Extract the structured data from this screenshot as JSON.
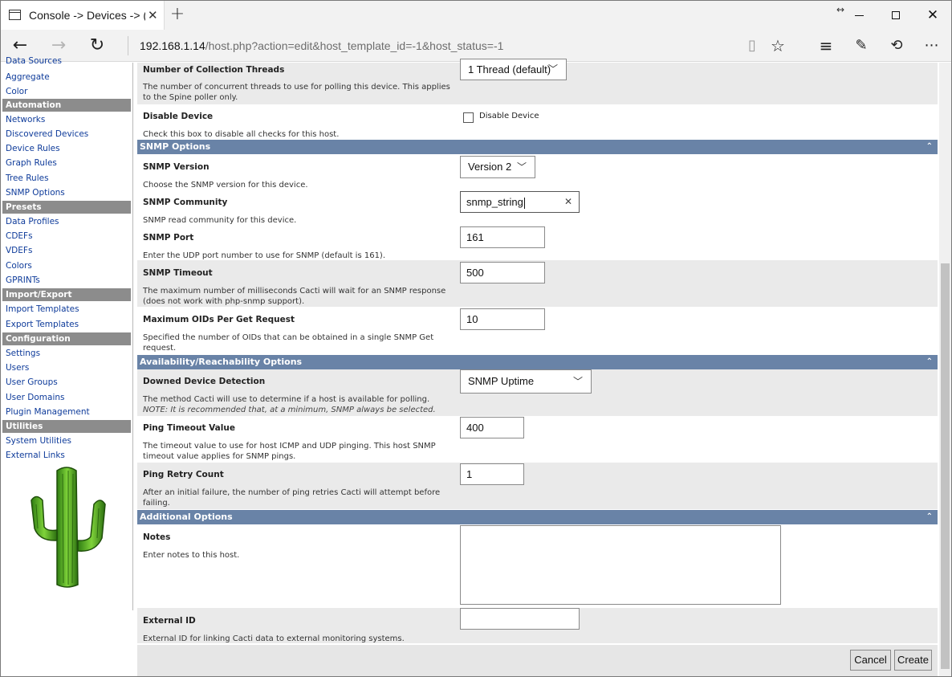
{
  "browser": {
    "tab_title": "Console -> Devices -> (",
    "tab_close": "✕",
    "new_tab": "+",
    "address_host": "192.168.1.14",
    "address_path": "/host.php?action=edit&host_template_id=-1&host_status=-1"
  },
  "sidebar": {
    "partial_item": "Data Sources",
    "groups": [
      {
        "type": "item",
        "label": "Aggregate"
      },
      {
        "type": "item",
        "label": "Color"
      },
      {
        "type": "header",
        "label": "Automation"
      },
      {
        "type": "item",
        "label": "Networks"
      },
      {
        "type": "item",
        "label": "Discovered Devices"
      },
      {
        "type": "item",
        "label": "Device Rules"
      },
      {
        "type": "item",
        "label": "Graph Rules"
      },
      {
        "type": "item",
        "label": "Tree Rules"
      },
      {
        "type": "item",
        "label": "SNMP Options"
      },
      {
        "type": "header",
        "label": "Presets"
      },
      {
        "type": "item",
        "label": "Data Profiles"
      },
      {
        "type": "item",
        "label": "CDEFs"
      },
      {
        "type": "item",
        "label": "VDEFs"
      },
      {
        "type": "item",
        "label": "Colors"
      },
      {
        "type": "item",
        "label": "GPRINTs"
      },
      {
        "type": "header",
        "label": "Import/Export"
      },
      {
        "type": "item",
        "label": "Import Templates"
      },
      {
        "type": "item",
        "label": "Export Templates"
      },
      {
        "type": "header",
        "label": "Configuration"
      },
      {
        "type": "item",
        "label": "Settings"
      },
      {
        "type": "item",
        "label": "Users"
      },
      {
        "type": "item",
        "label": "User Groups"
      },
      {
        "type": "item",
        "label": "User Domains"
      },
      {
        "type": "item",
        "label": "Plugin Management"
      },
      {
        "type": "header",
        "label": "Utilities"
      },
      {
        "type": "item",
        "label": "System Utilities"
      },
      {
        "type": "item",
        "label": "External Links"
      }
    ]
  },
  "form": {
    "threads": {
      "label": "Number of Collection Threads",
      "description": "The number of concurrent threads to use for polling this device. This applies to the Spine poller only.",
      "value": "1 Thread (default)"
    },
    "disable": {
      "label": "Disable Device",
      "description": "Check this box to disable all checks for this host.",
      "checkbox_label": "Disable Device",
      "checked": false
    },
    "snmp_section": "SNMP Options",
    "snmp_version": {
      "label": "SNMP Version",
      "description": "Choose the SNMP version for this device.",
      "value": "Version 2"
    },
    "snmp_community": {
      "label": "SNMP Community",
      "description": "SNMP read community for this device.",
      "value": "snmp_string"
    },
    "snmp_port": {
      "label": "SNMP Port",
      "description": "Enter the UDP port number to use for SNMP (default is 161).",
      "value": "161"
    },
    "snmp_timeout": {
      "label": "SNMP Timeout",
      "description": "The maximum number of milliseconds Cacti will wait for an SNMP response (does not work with php-snmp support).",
      "value": "500"
    },
    "max_oids": {
      "label": "Maximum OIDs Per Get Request",
      "description": "Specified the number of OIDs that can be obtained in a single SNMP Get request.",
      "value": "10"
    },
    "avail_section": "Availability/Reachability Options",
    "downed_detection": {
      "label": "Downed Device Detection",
      "description": "The method Cacti will use to determine if a host is available for polling.",
      "note": "NOTE: It is recommended that, at a minimum, SNMP always be selected.",
      "value": "SNMP Uptime"
    },
    "ping_timeout": {
      "label": "Ping Timeout Value",
      "description": "The timeout value to use for host ICMP and UDP pinging. This host SNMP timeout value applies for SNMP pings.",
      "value": "400"
    },
    "ping_retry": {
      "label": "Ping Retry Count",
      "description": "After an initial failure, the number of ping retries Cacti will attempt before failing.",
      "value": "1"
    },
    "additional_section": "Additional Options",
    "notes": {
      "label": "Notes",
      "description": "Enter notes to this host.",
      "value": ""
    },
    "external_id": {
      "label": "External ID",
      "description": "External ID for linking Cacti data to external monitoring systems.",
      "value": ""
    }
  },
  "buttons": {
    "cancel": "Cancel",
    "create": "Create"
  },
  "colors": {
    "section_header": "#6983a7",
    "sidebar_header": "#8c8c8c",
    "link": "#0e3b9a"
  }
}
